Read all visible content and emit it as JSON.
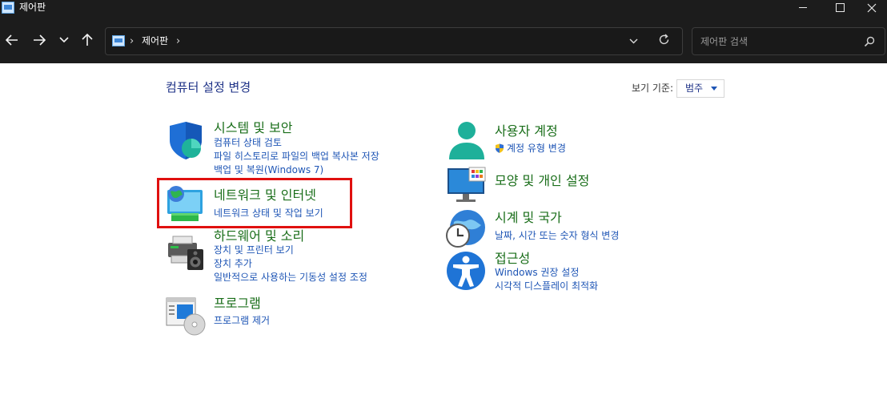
{
  "window": {
    "title": "제어판",
    "icon": "control-panel-icon",
    "controls": [
      "minimize-icon",
      "maximize-icon",
      "close-icon"
    ]
  },
  "address_bar": {
    "breadcrumb": [
      "제어판"
    ],
    "separator": "›",
    "icons": [
      "back-arrow-icon",
      "forward-arrow-icon",
      "recent-locations-icon",
      "up-arrow-icon",
      "dropdown-icon",
      "refresh-icon"
    ]
  },
  "search": {
    "placeholder": "제어판 검색",
    "value": "",
    "icon": "search-icon"
  },
  "main": {
    "title": "컴퓨터 설정 변경",
    "view_by_label": "보기 기준:",
    "view_by_value": "범주"
  },
  "categories": [
    {
      "title": "시스템 및 보안",
      "icon": "shield-security-icon",
      "links": [
        "컴퓨터 상태 검토",
        "파일 히스토리로 파일의 백업 복사본 저장",
        "백업 및 복원(Windows 7)"
      ]
    },
    {
      "title": "네트워크 및 인터넷",
      "icon": "network-globe-icon",
      "links": [
        "네트워크 상태 및 작업 보기"
      ]
    },
    {
      "title": "하드웨어 및 소리",
      "icon": "printer-speaker-icon",
      "links": [
        "장치 및 프린터 보기",
        "장치 추가",
        "일반적으로 사용하는 기동성 설정 조정"
      ]
    },
    {
      "title": "프로그램",
      "icon": "programs-disc-icon",
      "links": [
        "프로그램 제거"
      ]
    },
    {
      "title": "사용자 계정",
      "icon": "user-accounts-icon",
      "links": [
        "계정 유형 변경"
      ]
    },
    {
      "title": "모양 및 개인 설정",
      "icon": "appearance-monitor-icon",
      "links": []
    },
    {
      "title": "시계 및 국가",
      "icon": "clock-globe-icon",
      "links": [
        "날짜, 시간 또는 숫자 형식 변경"
      ]
    },
    {
      "title": "접근성",
      "icon": "accessibility-icon",
      "links": [
        "Windows 권장 설정",
        "시각적 디스플레이 최적화"
      ]
    }
  ],
  "colors": {
    "titlebar_bg": "#1c1c1c",
    "category_title": "#1a6e1a",
    "link": "#1e55b5",
    "page_title": "#1e3287",
    "highlight": "#e0100f"
  }
}
